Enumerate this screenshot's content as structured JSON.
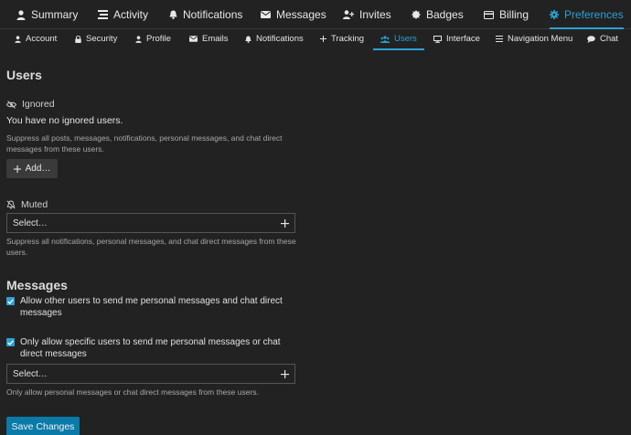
{
  "top_nav": [
    {
      "label": "Summary",
      "icon": "user-icon"
    },
    {
      "label": "Activity",
      "icon": "stream-icon"
    },
    {
      "label": "Notifications",
      "icon": "bell-icon"
    },
    {
      "label": "Messages",
      "icon": "envelope-icon"
    },
    {
      "label": "Invites",
      "icon": "user-plus-icon"
    },
    {
      "label": "Badges",
      "icon": "certificate-icon"
    },
    {
      "label": "Billing",
      "icon": "credit-card-icon"
    },
    {
      "label": "Preferences",
      "icon": "gear-icon",
      "active": true
    }
  ],
  "sub_nav": [
    {
      "label": "Account",
      "icon": "user-icon"
    },
    {
      "label": "Security",
      "icon": "lock-icon"
    },
    {
      "label": "Profile",
      "icon": "user-icon"
    },
    {
      "label": "Emails",
      "icon": "envelope-icon"
    },
    {
      "label": "Notifications",
      "icon": "bell-icon"
    },
    {
      "label": "Tracking",
      "icon": "plus-icon"
    },
    {
      "label": "Users",
      "icon": "users-icon",
      "active": true
    },
    {
      "label": "Interface",
      "icon": "desktop-icon"
    },
    {
      "label": "Navigation Menu",
      "icon": "bars-icon"
    },
    {
      "label": "Chat",
      "icon": "comment-icon"
    }
  ],
  "users": {
    "heading": "Users",
    "ignored": {
      "label": "Ignored",
      "icon": "eye-slash-icon",
      "status": "You have no ignored users.",
      "description": "Suppress all posts, messages, notifications, personal messages, and chat direct messages from these users.",
      "add_button": "Add…"
    },
    "muted": {
      "label": "Muted",
      "icon": "bell-slash-icon",
      "select_placeholder": "Select…",
      "description": "Suppress all notifications, personal messages, and chat direct messages from these users."
    }
  },
  "messages": {
    "heading": "Messages",
    "allow_pm": {
      "label": "Allow other users to send me personal messages and chat direct messages",
      "checked": true
    },
    "only_allow": {
      "label": "Only allow specific users to send me personal messages or chat direct messages",
      "checked": true
    },
    "select_placeholder": "Select…",
    "description": "Only allow personal messages or chat direct messages from these users."
  },
  "save_button": "Save Changes",
  "colors": {
    "accent": "#2aa1d4",
    "background": "#222222",
    "save_button": "#0a7aa8"
  }
}
